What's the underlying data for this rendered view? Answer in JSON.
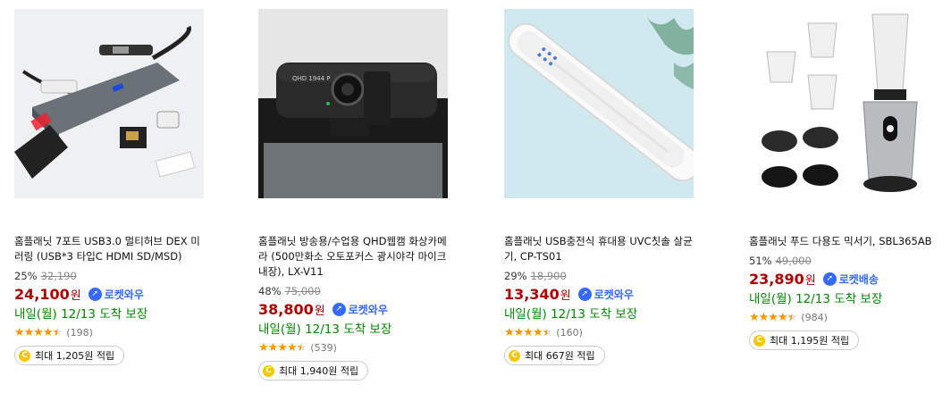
{
  "products": [
    {
      "title": "홈플래닛 7포트 USB3.0 멀티허브 DEX 미러링 (USB*3 타입C HDMI SD/MSD)",
      "discount": "25%",
      "original_price": "32,190",
      "price": "24,100",
      "currency": "원",
      "badge": "로켓와우",
      "delivery": "내일(월) 12/13 도착 보장",
      "rating_stars": 4.5,
      "review_count": "(198)",
      "cashback": "최대 1,205원 적립"
    },
    {
      "title": "홈플래닛 방송용/수업용 QHD웹캠 화상카메라 (500만화소 오토포커스 광시야각 마이크내장), LX-V11",
      "discount": "48%",
      "original_price": "75,000",
      "price": "38,800",
      "currency": "원",
      "badge": "로켓와우",
      "delivery": "내일(월) 12/13 도착 보장",
      "rating_stars": 4.5,
      "review_count": "(539)",
      "cashback": "최대 1,940원 적립",
      "image_text": "QHD 1944 P"
    },
    {
      "title": "홈플래닛 USB충전식 휴대용 UVC칫솔 살균기, CP-TS01",
      "discount": "29%",
      "original_price": "18,900",
      "price": "13,340",
      "currency": "원",
      "badge": "로켓와우",
      "delivery": "내일(월) 12/13 도착 보장",
      "rating_stars": 4.5,
      "review_count": "(160)",
      "cashback": "최대 667원 적립"
    },
    {
      "title": "홈플래닛 푸드 다용도 믹서기, SBL365AB",
      "discount": "51%",
      "original_price": "49,000",
      "price": "23,890",
      "currency": "원",
      "badge": "로켓배송",
      "delivery": "내일(월) 12/13 도착 보장",
      "rating_stars": 4.5,
      "review_count": "(984)",
      "cashback": "최대 1,195원 적립"
    }
  ],
  "colors": {
    "price": "#ae0000",
    "badge": "#346aff",
    "delivery": "#008c00",
    "star": "#ff9600",
    "coin": "#f7c600"
  },
  "icons": {
    "badge": "rocket-icon",
    "cashback": "coin-icon",
    "rating": "star-icon"
  }
}
